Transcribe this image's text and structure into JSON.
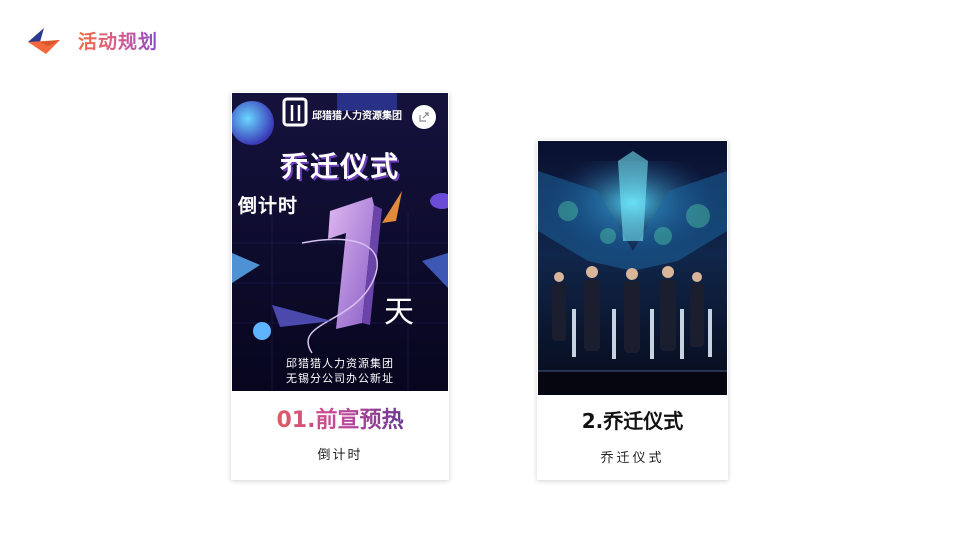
{
  "header": {
    "title": "活动规划",
    "logo_icon": "arrow-logo-icon",
    "colors": {
      "orange": "#f26a3c",
      "navy": "#2b3a8c",
      "purple": "#8a4dc9"
    }
  },
  "cards": [
    {
      "title": "01.前宣预热",
      "subtitle": "倒计时",
      "poster": {
        "brand": "邱猎猎人力资源集团",
        "heading": "乔迁仪式",
        "countdown_label": "倒计时",
        "number": "1",
        "day": "天",
        "line1": "邱猎猎人力资源集团",
        "line2": "无锡分公司办公新址",
        "share_icon": "share-icon"
      }
    },
    {
      "title": "2.乔迁仪式",
      "subtitle": "乔迁仪式"
    }
  ]
}
